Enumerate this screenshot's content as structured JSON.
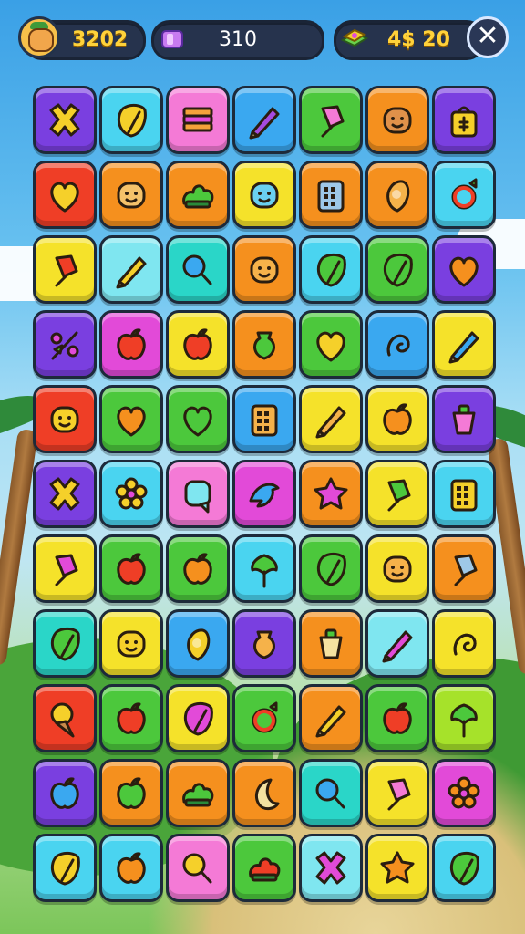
{
  "hud": {
    "score": "3202",
    "gems": "310",
    "coins": "4$ 20",
    "close_icon": "✕"
  },
  "colors": {
    "purple": "#7a3fe0",
    "cyan": "#4ad4f0",
    "pink": "#f47ad6",
    "blue": "#3aa8f0",
    "green": "#4cc83c",
    "orange": "#f5901e",
    "yellow": "#f5e22a",
    "red": "#ef3e26",
    "lime": "#a6e22a",
    "teal": "#2ad6c8",
    "lightcyan": "#7fe6f0",
    "magenta": "#e24ad8"
  },
  "board": [
    [
      [
        "purple",
        "x",
        "#f5d02a"
      ],
      [
        "cyan",
        "leaf",
        "#f5d02a"
      ],
      [
        "pink",
        "stack",
        "#f5a23a"
      ],
      [
        "blue",
        "crayon",
        "#a64ae0"
      ],
      [
        "green",
        "popsicle",
        "#f47ad6"
      ],
      [
        "orange",
        "face",
        "#e0914a"
      ],
      [
        "purple",
        "bag",
        "#f5d02a"
      ]
    ],
    [
      [
        "red",
        "heart",
        "#f5d02a"
      ],
      [
        "orange",
        "face",
        "#f5c26a"
      ],
      [
        "orange",
        "bush",
        "#4cc83c"
      ],
      [
        "yellow",
        "face",
        "#6ad0f0"
      ],
      [
        "orange",
        "phone",
        "#9ec8e8"
      ],
      [
        "orange",
        "drop",
        "#f5b24a"
      ],
      [
        "cyan",
        "ring",
        "#ef3e26"
      ]
    ],
    [
      [
        "yellow",
        "popsicle",
        "#ef3e26"
      ],
      [
        "lightcyan",
        "crayon",
        "#f5d02a"
      ],
      [
        "teal",
        "magnifier",
        "#3aa8f0"
      ],
      [
        "orange",
        "face",
        "#f5b24a"
      ],
      [
        "cyan",
        "leaf",
        "#4cc83c"
      ],
      [
        "green",
        "leaf",
        "#4cc83c"
      ],
      [
        "purple",
        "heart",
        "#f5901e"
      ]
    ],
    [
      [
        "purple",
        "branch",
        "#f5d02a"
      ],
      [
        "magenta",
        "apple",
        "#ef3e26"
      ],
      [
        "yellow",
        "apple",
        "#ef3e26"
      ],
      [
        "orange",
        "vase",
        "#4cc83c"
      ],
      [
        "green",
        "heart",
        "#f5d02a"
      ],
      [
        "blue",
        "swirl",
        "#f5d02a"
      ],
      [
        "yellow",
        "crayon",
        "#3aa8f0"
      ]
    ],
    [
      [
        "red",
        "face",
        "#f5d02a"
      ],
      [
        "green",
        "heart",
        "#f5901e"
      ],
      [
        "green",
        "heart",
        "#4cc83c"
      ],
      [
        "blue",
        "phone",
        "#f5b24a"
      ],
      [
        "yellow",
        "crayon",
        "#f5b24a"
      ],
      [
        "yellow",
        "apple",
        "#f5901e"
      ],
      [
        "purple",
        "cup",
        "#f47ad6"
      ]
    ],
    [
      [
        "purple",
        "x",
        "#f5d02a"
      ],
      [
        "cyan",
        "flower",
        "#f5d02a"
      ],
      [
        "pink",
        "bubble",
        "#7fe6f0"
      ],
      [
        "magenta",
        "dolphin",
        "#3aa8f0"
      ],
      [
        "orange",
        "star",
        "#e24ad8"
      ],
      [
        "yellow",
        "popsicle",
        "#4cc83c"
      ],
      [
        "cyan",
        "phone",
        "#f5d02a"
      ]
    ],
    [
      [
        "yellow",
        "popsicle",
        "#e24ad8"
      ],
      [
        "green",
        "apple",
        "#ef3e26"
      ],
      [
        "green",
        "apple",
        "#f5901e"
      ],
      [
        "cyan",
        "tree",
        "#4cc83c"
      ],
      [
        "green",
        "leaf",
        "#4cc83c"
      ],
      [
        "yellow",
        "face",
        "#f5b24a"
      ],
      [
        "orange",
        "popsicle",
        "#9ec8e8"
      ]
    ],
    [
      [
        "teal",
        "leaf",
        "#4cc83c"
      ],
      [
        "yellow",
        "face",
        "#f5d02a"
      ],
      [
        "blue",
        "drop",
        "#f5d02a"
      ],
      [
        "purple",
        "vase",
        "#f5b24a"
      ],
      [
        "orange",
        "cup",
        "#f5e2a0"
      ],
      [
        "lightcyan",
        "crayon",
        "#e24ad8"
      ],
      [
        "yellow",
        "swirl",
        "#f5901e"
      ]
    ],
    [
      [
        "red",
        "cone",
        "#f5d02a"
      ],
      [
        "green",
        "apple",
        "#ef3e26"
      ],
      [
        "yellow",
        "leaf",
        "#e24ad8"
      ],
      [
        "green",
        "ring",
        "#ef3e26"
      ],
      [
        "orange",
        "crayon",
        "#f5d02a"
      ],
      [
        "green",
        "apple",
        "#ef3e26"
      ],
      [
        "lime",
        "tree",
        "#4cc83c"
      ]
    ],
    [
      [
        "purple",
        "apple",
        "#3aa8f0"
      ],
      [
        "orange",
        "apple",
        "#4cc83c"
      ],
      [
        "orange",
        "bush",
        "#4cc83c"
      ],
      [
        "orange",
        "moon",
        "#f5e2a0"
      ],
      [
        "teal",
        "magnifier",
        "#3aa8f0"
      ],
      [
        "yellow",
        "popsicle",
        "#f47ad6"
      ],
      [
        "magenta",
        "flower",
        "#f5901e"
      ]
    ],
    [
      [
        "cyan",
        "leaf",
        "#f5d02a"
      ],
      [
        "cyan",
        "apple",
        "#f5901e"
      ],
      [
        "pink",
        "magnifier",
        "#f5d02a"
      ],
      [
        "green",
        "bush",
        "#ef3e26"
      ],
      [
        "lightcyan",
        "x",
        "#e24ad8"
      ],
      [
        "yellow",
        "star",
        "#f5901e"
      ],
      [
        "cyan",
        "leaf",
        "#4cc83c"
      ]
    ]
  ]
}
